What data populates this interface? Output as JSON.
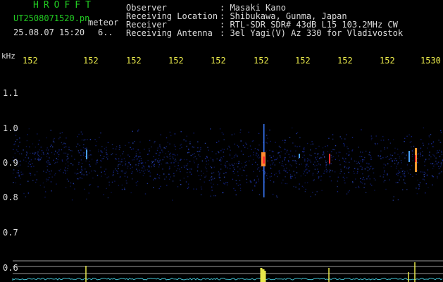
{
  "header": {
    "app_title": "HROFFT",
    "filename": "UT2508071520.pn",
    "mode": "meteor",
    "date_time": "25.08.07 15:20",
    "extra": "6..",
    "observer_label": "Observer",
    "observer_value": ": Masaki Kano",
    "location_label": "Receiving Location",
    "location_value": ": Shibukawa, Gunma, Japan",
    "receiver_label": "Receiver",
    "receiver_value": ": RTL-SDR SDR# 43dB L15 103.2MHz CW",
    "antenna_label": "Receiving Antenna",
    "antenna_value": ": 3el Yagi(V) Az 330 for Vladivostok"
  },
  "axes": {
    "y_unit": "kHz",
    "y_ticks": [
      "1.1",
      "1.0",
      "0.9",
      "0.8",
      "0.7",
      "0.6"
    ],
    "x_ticks": [
      "152",
      "152",
      "152",
      "152",
      "152",
      "152",
      "152",
      "152",
      "152",
      "1530"
    ]
  },
  "colors": {
    "label_green": "#22cc22",
    "text_white": "#dcdcdc",
    "tick_yellow": "#e8e84a",
    "noise_blue": "#1a2a9a",
    "signal_red": "#ff3030",
    "baseline_cyan": "#40c0d0"
  }
}
